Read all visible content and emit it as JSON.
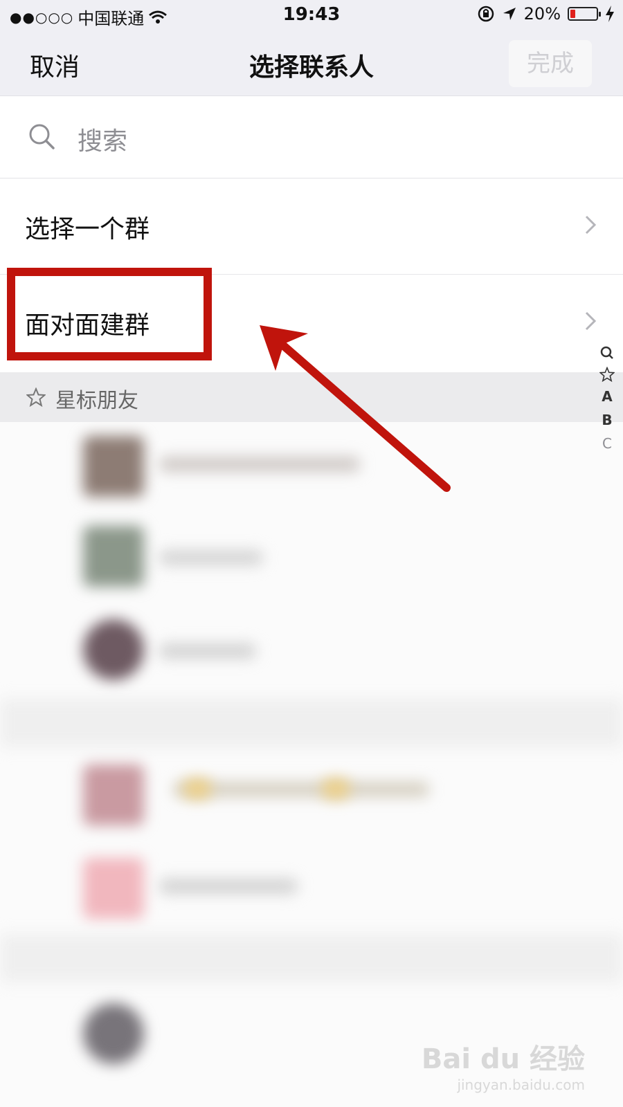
{
  "status_bar": {
    "signal": "●●○○○",
    "carrier": "中国联通",
    "time": "19:43",
    "battery": "20%",
    "battery_level": 0.2,
    "accent_low_battery": "#e0201c"
  },
  "nav": {
    "cancel_label": "取消",
    "title": "选择联系人",
    "done_label": "完成"
  },
  "search": {
    "placeholder": "搜索"
  },
  "rows": [
    {
      "label": "选择一个群"
    },
    {
      "label": "面对面建群"
    }
  ],
  "section": {
    "label": "星标朋友"
  },
  "index_bar": [
    "A",
    "B",
    "C"
  ],
  "annotation": {
    "highlight_color": "#c0140c"
  },
  "watermark": {
    "logo_text": "Bai du 经验",
    "url": "jingyan.baidu.com"
  }
}
